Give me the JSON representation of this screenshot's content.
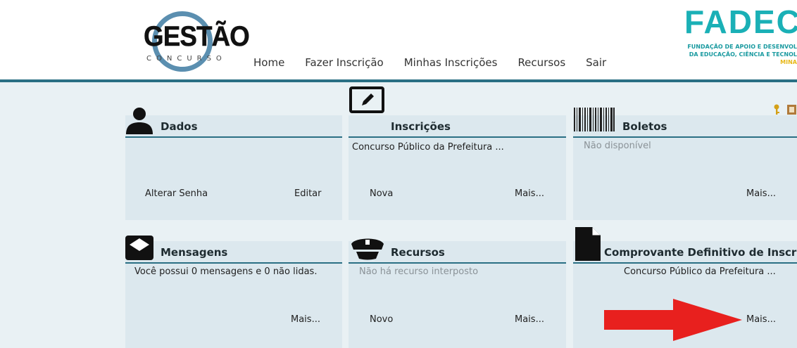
{
  "header": {
    "logo_main": "GESTÃO",
    "logo_sub": "CONCURSO",
    "partner_logo": "FADECI",
    "partner_line1": "FUNDAÇÃO DE APOIO E DESENVOL",
    "partner_line2": "DA EDUCAÇÃO, CIÊNCIA E TECNOL",
    "partner_line3": "MINA"
  },
  "nav": {
    "items": [
      {
        "label": "Home"
      },
      {
        "label": "Fazer Inscrição"
      },
      {
        "label": "Minhas Inscrições"
      },
      {
        "label": "Recursos"
      },
      {
        "label": "Sair"
      }
    ]
  },
  "panels": {
    "dados": {
      "title": "Dados",
      "link_left": "Alterar Senha",
      "link_right": "Editar"
    },
    "inscricoes": {
      "title": "Inscrições",
      "text": "Concurso Público da Prefeitura ...",
      "link_left": "Nova",
      "link_right": "Mais..."
    },
    "boletos": {
      "title": "Boletos",
      "text": "Não disponível",
      "link_right": "Mais..."
    },
    "mensagens": {
      "title": "Mensagens",
      "text": "Você possui 0 mensagens e 0 não lidas.",
      "link_right": "Mais..."
    },
    "recursos": {
      "title": "Recursos",
      "text": "Não há recurso interposto",
      "link_left": "Novo",
      "link_right": "Mais..."
    },
    "comprovante": {
      "title": "Comprovante Definitivo de Inscrição",
      "text": "Concurso Público da Prefeitura ...",
      "link_right": "Mais..."
    }
  },
  "colors": {
    "accent": "#2a6f84",
    "panel_bg": "#dce8ee",
    "page_bg": "#e9f1f4",
    "arrow": "#e8201e",
    "fadeci": "#1ab0b6"
  },
  "icons": [
    "user-icon",
    "edit-icon",
    "barcode-icon",
    "envelope-icon",
    "police-cap-icon",
    "document-icon",
    "key-icon",
    "logout-icon",
    "red-arrow"
  ]
}
